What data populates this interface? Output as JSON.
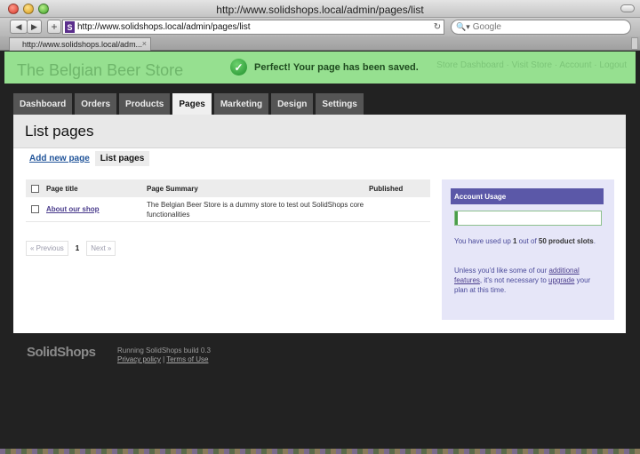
{
  "window": {
    "title": "http://www.solidshops.local/admin/pages/list"
  },
  "toolbar": {
    "back_icon": "◀",
    "fwd_icon": "▶",
    "plus_icon": "+",
    "favicon_letter": "S",
    "url": "http://www.solidshops.local/admin/pages/list",
    "reload_icon": "↻",
    "search_icon": "🔍▾",
    "search_placeholder": "Google"
  },
  "browser_tab": {
    "label": "http://www.solidshops.local/adm...",
    "close_icon": "×"
  },
  "header": {
    "store_name": "The Belgian Beer Store",
    "links": "Store Dashboard · Visit Store · Account · Logout"
  },
  "notice": {
    "check_icon": "✓",
    "message": "Perfect! Your page has been saved."
  },
  "admin_tabs": [
    {
      "label": "Dashboard"
    },
    {
      "label": "Orders"
    },
    {
      "label": "Products"
    },
    {
      "label": "Pages"
    },
    {
      "label": "Marketing"
    },
    {
      "label": "Design"
    },
    {
      "label": "Settings"
    }
  ],
  "page": {
    "title": "List pages",
    "subtabs": {
      "add": "Add new page",
      "list": "List pages"
    }
  },
  "table": {
    "headers": {
      "title": "Page title",
      "summary": "Page Summary",
      "published": "Published"
    },
    "rows": [
      {
        "title": "About our shop",
        "summary": "The Belgian Beer Store is a dummy store to test out SolidShops core functionalities",
        "published": ""
      }
    ]
  },
  "pager": {
    "prev": "« Previous",
    "current": "1",
    "next": "Next »"
  },
  "usage": {
    "title": "Account Usage",
    "level": 0.02,
    "text_pre": "You have used up ",
    "used": "1",
    "text_mid": " out of ",
    "limit": "50 product slots",
    "text_end": ".",
    "upsell_pre": "Unless you'd like some of our ",
    "upsell_link1": "additional features",
    "upsell_mid": ", it's not necessary to ",
    "upsell_link2": "upgrade",
    "upsell_end": " your plan at this time."
  },
  "footer": {
    "logo": "SolidShops",
    "build": "Running SolidShops build 0.3",
    "privacy": "Privacy policy",
    "separator": "|",
    "terms": "Terms of Use"
  },
  "colors": {
    "notice_bg": "#96e090",
    "tab_bg": "#555555",
    "sidebar_head": "#5b58a8",
    "meter_fill": "#4a9e4a"
  }
}
